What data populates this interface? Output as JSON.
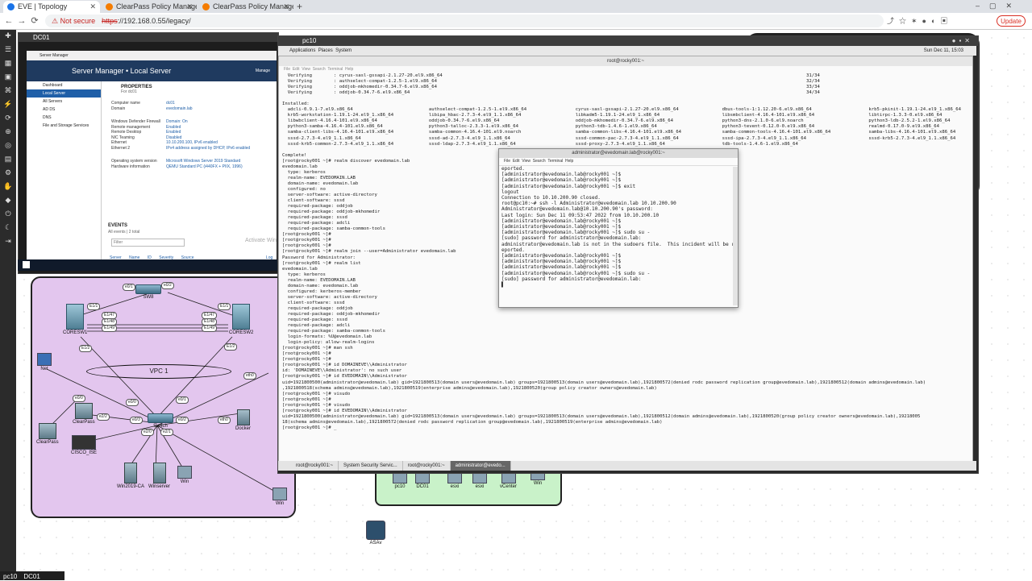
{
  "browser": {
    "tabs": [
      {
        "label": "EVE | Topology",
        "active": true,
        "color": "#1a73e8"
      },
      {
        "label": "ClearPass Policy Manager - Aruba",
        "active": false,
        "color": "#f57c00"
      },
      {
        "label": "ClearPass Policy Manager - Aruba",
        "active": false,
        "color": "#f57c00"
      }
    ],
    "new_tab": "+",
    "not_secure": "⚠ Not secure",
    "url_scheme": "https",
    "url_rest": "://192.168.0.55/legacy/",
    "update_label": "Update"
  },
  "eve": {
    "bottom_tabs": [
      "pc10",
      "DC01"
    ],
    "nodes": {
      "sw8": "SW8",
      "coresw1": "CORESW1",
      "coresw2": "CORESW2",
      "net": "Net",
      "clearpass1": "ClearPass",
      "clearpass2": "ClearPass",
      "cisco_ise": "CISCO_ISE",
      "switch": "Switch",
      "docker": "Docker",
      "win2019": "Win2019-CA",
      "winserver": "Winserver",
      "win1": "Win",
      "win2": "Win",
      "pc10": "pc10",
      "dc01": "DC01",
      "esxi1": "esxi",
      "esxi2": "esxi",
      "vcenter": "vCenter",
      "win3": "Win",
      "asav": "ASAv"
    },
    "cloud_label": "VPC 1",
    "ports": [
      "e0/1",
      "e0/2",
      "e1/0",
      "e1/1",
      "E1/1",
      "E1/1",
      "E1/47",
      "E1/48",
      "E1/49",
      "E1/47",
      "E1/48",
      "E1/49",
      "E1/2",
      "E1/2",
      "eth0",
      "e0/1",
      "e0/0",
      "e0/3",
      "e0/2",
      "e2/0",
      "e2/1",
      "e2/2",
      "e0/0",
      "eth0",
      "e0",
      "e0",
      "e0",
      "e0/1",
      "e0",
      "e0",
      "e0",
      "e0/1"
    ]
  },
  "dc01_window": {
    "title": "DC01",
    "sm_window_title": "Server Manager",
    "sm_header": "Server Manager • Local Server",
    "manage": "Manage",
    "sidebar": [
      "Dashboard",
      "Local Server",
      "All Servers",
      "AD DS",
      "DNS",
      "File and Storage Services"
    ],
    "properties_title": "PROPERTIES",
    "properties_sub": "For dc01",
    "props": [
      [
        "Computer name",
        "dc01"
      ],
      [
        "Domain",
        "evedomain.lab"
      ],
      [
        "Windows Defender Firewall",
        "Domain: On"
      ],
      [
        "Remote management",
        "Enabled"
      ],
      [
        "Remote Desktop",
        "Enabled"
      ],
      [
        "NIC Teaming",
        "Disabled"
      ],
      [
        "Ethernet",
        "10.10.200.100, IPv6 enabled"
      ],
      [
        "Ethernet 2",
        "IPv4 address assigned by DHCP, IPv6 enabled"
      ],
      [
        "Operating system version",
        "Microsoft Windows Server 2019 Standard"
      ],
      [
        "Hardware information",
        "QEMU Standard PC (i440FX + PIIX, 1996)"
      ]
    ],
    "events_title": "EVENTS",
    "events_sub": "All events | 2 total",
    "filter_placeholder": "Filter",
    "events_cols": [
      "Server Name",
      "ID",
      "Severity",
      "Source",
      "Log"
    ],
    "activate": "Activate Win"
  },
  "pc10_window": {
    "title": "pc10",
    "gnome": {
      "applications": "Applications",
      "places": "Places",
      "system": "System",
      "clock": "Sun Dec 11, 15:03"
    },
    "term1": {
      "title": "root@rocky001:~",
      "menu": [
        "File",
        "Edit",
        "View",
        "Search",
        "Terminal",
        "Help"
      ],
      "top": "  Verifying        : cyrus-sasl-gssapi-2.1.27-20.el9.x86_64                                                                                                                                      31/34\n  Verifying        : authselect-compat-1.2.5-1.el9.x86_64                                                                                                                                        32/34\n  Verifying        : oddjob-mkhomedir-0.34.7-6.el9.x86_64                                                                                                                                        33/34\n  Verifying        : oddjob-0.34.7-6.el9.x86_64                                                                                                                                                  34/34\n\nInstalled:\n  adcli-0.9.1-7.el9.x86_64                            authselect-compat-1.2.5-1.el9.x86_64                  cyrus-sasl-gssapi-2.1.27-20.el9.x86_64                dbus-tools-1:1.12.20-6.el9.x86_64                     krb5-pkinit-1.19.1-24.el9_1.x86_64\n  krb5-workstation-1.19.1-24.el9_1.x86_64             libipa_hbac-2.7.3-4.el9_1.1.x86_64                    libkadm5-1.19.1-24.el9_1.x86_64                       libsmbclient-4.16.4-101.el9.x86_64                    libtirpc-1.3.3-0.el9.x86_64\n  libwbclient-4.16.4-101.el9.x86_64                   oddjob-0.34.7-6.el9.x86_64                            oddjob-mkhomedir-0.34.7-6.el9.x86_64                  python3-dns-2.1.0-6.el9.noarch                        python3-ldb-2.5.2-1.el9.x86_64\n  python3-samba-4.16.4-101.el9.x86_64                 python3-talloc-2.3.3-1.el9.x86_64                     python3-tdb-1.4.6-1.el9.x86_64                        python3-tevent-0.12.0-0.el9.x86_64                    realmd-0.17.0-9.el9.x86_64\n  samba-client-libs-4.16.4-101.el9.x86_64             samba-common-4.16.4-101.el9.noarch                    samba-common-libs-4.16.4-101.el9.x86_64               samba-common-tools-4.16.4-101.el9.x86_64              samba-libs-4.16.4-101.el9.x86_64\n  sssd-2.7.3-4.el9_1.1.x86_64                         sssd-ad-2.7.3-4.el9_1.1.x86_64                        sssd-common-pac-2.7.3-4.el9_1.1.x86_64                sssd-ipa-2.7.3-4.el9_1.1.x86_64                       sssd-krb5-2.7.3-4.el9_1.1.x86_64\n  sssd-krb5-common-2.7.3-4.el9_1.1.x86_64             sssd-ldap-2.7.3-4.el9_1.1.x86_64                      sssd-proxy-2.7.3-4.el9_1.1.x86_64                     tdb-tools-1.4.6-1.el9.x86_64\n\nComplete!\n[root@rocky001 ~]# realm discover evedomain.lab\nevedomain.lab\n  type: kerberos\n  realm-name: EVEDOMAIN.LAB\n  domain-name: evedomain.lab\n  configured: no\n  server-software: active-directory\n  client-software: sssd\n  required-package: oddjob\n  required-package: oddjob-mkhomedir\n  required-package: sssd\n  required-package: adcli\n  required-package: samba-common-tools\n[root@rocky001 ~]#\n[root@rocky001 ~]#\n[root@rocky001 ~]#\n[root@rocky001 ~]# realm join --user=Administrator evedomain.lab\nPassword for Administrator:\n[root@rocky001 ~]# realm list\nevedomain.lab\n  type: kerberos\n  realm-name: EVEDOMAIN.LAB\n  domain-name: evedomain.lab\n  configured: kerberos-member\n  server-software: active-directory\n  client-software: sssd\n  required-package: oddjob\n  required-package: oddjob-mkhomedir\n  required-package: sssd\n  required-package: adcli\n  required-package: samba-common-tools\n  login-formats: %U@evedomain.lab\n  login-policy: allow-realm-logins\n[root@rocky001 ~]# man ssh\n[root@rocky001 ~]#\n[root@rocky001 ~]#\n[root@rocky001 ~]# id DOMAINEVE\\\\Administrator\nid: 'DOMAINEVE\\\\Administrator': no such user\n[root@rocky001 ~]# id EVEDOMAIN\\\\Administrator\nuid=1921800500(administrator@evedomain.lab) gid=1921800513(domain users@evedomain.lab) groups=1921800513(domain users@evedomain.lab),1921800572(denied rodc password replication group@evedomain.lab),1921800512(domain admins@evedomain.lab)\n,1921800518(schema admins@evedomain.lab),1921800519(enterprise admins@evedomain.lab),1921800520(group policy creator owners@evedomain.lab)\n[root@rocky001 ~]# visudo\n[root@rocky001 ~]#\n[root@rocky001 ~]# visudo\n[root@rocky001 ~]# id EVEDOMAIN\\\\Administrator\nuid=1921800500(administrator@evedomain.lab) gid=1921800513(domain users@evedomain.lab) groups=1921800513(domain users@evedomain.lab),1921800512(domain admins@evedomain.lab),1921800520(group policy creator owners@evedomain.lab),19218005\n18(schema admins@evedomain.lab),1921800572(denied rodc password replication group@evedomain.lab),1921800519(enterprise admins@evedomain.lab)\n[root@rocky001 ~]# _"
    },
    "term2": {
      "title": "administrator@evedomain.lab@rocky001:~",
      "menu": [
        "File",
        "Edit",
        "View",
        "Search",
        "Terminal",
        "Help"
      ],
      "text": "eported.\n[administrator@evedomain.lab@rocky001 ~]$\n[administrator@evedomain.lab@rocky001 ~]$\n[administrator@evedomain.lab@rocky001 ~]$ exit\nlogout\nConnection to 10.10.200.90 closed.\nroot@pc10:~# ssh -l Administrator@evedomain.lab 10.10.200.90\nAdministrator@evedomain.lab@10.10.200.90's password:\nLast login: Sun Dec 11 09:53:47 2022 from 10.10.200.10\n[administrator@evedomain.lab@rocky001 ~]$\n[administrator@evedomain.lab@rocky001 ~]$\n[administrator@evedomain.lab@rocky001 ~]$ sudo su -\n[sudo] password for administrator@evedomain.lab:\nadministrator@evedomain.lab is not in the sudoers file.  This incident will be r\neported.\n[administrator@evedomain.lab@rocky001 ~]$\n[administrator@evedomain.lab@rocky001 ~]$\n[administrator@evedomain.lab@rocky001 ~]$\n[administrator@evedomain.lab@rocky001 ~]$ sudo su -\n[sudo] password for administrator@evedomain.lab:\n▌"
    },
    "taskbar": [
      "root@rocky001:~",
      "System Security Servic...",
      "root@rocky001:~",
      "administrator@evedo..."
    ]
  }
}
